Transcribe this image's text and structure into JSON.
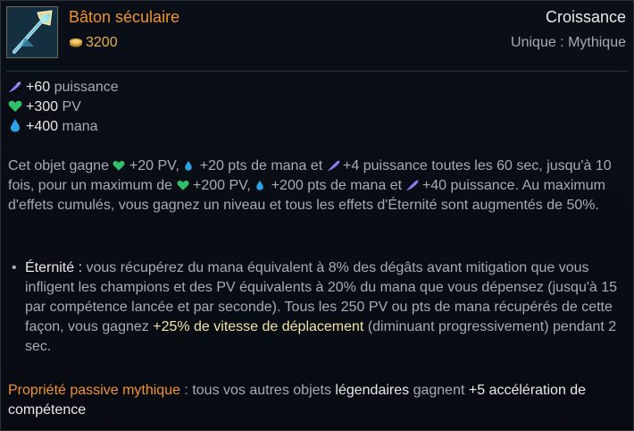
{
  "item": {
    "name": "Bâton séculaire",
    "gold": "3200",
    "category": "Croissance",
    "rarity": "Unique : Mythique",
    "icon": "ageless-staff-icon"
  },
  "stats": [
    {
      "icon": "ability-power-icon",
      "value": "+60",
      "label": "puissance"
    },
    {
      "icon": "health-icon",
      "value": "+300",
      "label": "PV"
    },
    {
      "icon": "mana-icon",
      "value": "+400",
      "label": "mana"
    }
  ],
  "description": {
    "p1": "Cet objet gagne",
    "hp20": "+20 PV,",
    "mana20": "+20 pts de mana et",
    "ap4": "+4 puissance toutes les 60 sec, jusqu'à 10 fois, pour un maximum de",
    "hp200": "+200 PV,",
    "mana200": "+200 pts de mana et",
    "ap40": "+40 puissance. Au maximum d'effets cumulés, vous gagnez un niveau et tous les effets d'Éternité sont augmentés de 50%."
  },
  "passive": {
    "bullet": "•",
    "name": "Éternité :",
    "text1": " vous récupérez du mana équivalent à 8% des dégâts avant mitigation que vous infligent les champions et des PV équivalents à 20% du mana que vous dépensez (jusqu'à 15 par compétence lancée et par seconde). Tous les 250 PV ou pts de mana récupérés de cette façon, vous gagnez ",
    "highlight": "+25% de vitesse de déplacement",
    "text2": " (diminuant progressivement) pendant 2 sec."
  },
  "mythic": {
    "label": "Propriété passive mythique",
    "text1": " : tous vos autres objets ",
    "legendary": "légendaires",
    "text2": " gagnent ",
    "bonus": "+5 accélération de compétence"
  },
  "colors": {
    "item_name": "#f0932a",
    "gold": "#e6b24c",
    "text": "#a7abb3",
    "highlight_white": "#e8e8e8",
    "highlight_yellow": "#f2e3a4",
    "ap": "#8c7bf2",
    "health": "#2fc06b",
    "mana": "#2aa4e6"
  }
}
